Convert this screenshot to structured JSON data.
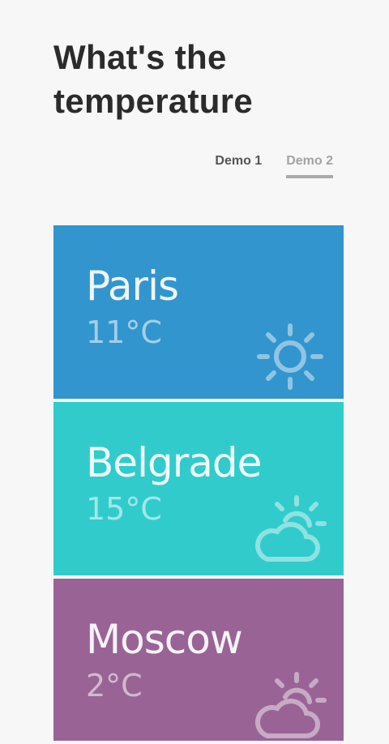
{
  "header": {
    "title": "What's the temperature"
  },
  "tabs": [
    {
      "label": "Demo 1",
      "active": false
    },
    {
      "label": "Demo 2",
      "active": true
    }
  ],
  "cards": [
    {
      "city": "Paris",
      "temp": "11°C",
      "icon": "sun-icon",
      "color": "#3395cd"
    },
    {
      "city": "Belgrade",
      "temp": "15°C",
      "icon": "partly-cloudy-icon",
      "color": "#32cbcb"
    },
    {
      "city": "Moscow",
      "temp": "2°C",
      "icon": "partly-cloudy-icon",
      "color": "#996495"
    }
  ]
}
